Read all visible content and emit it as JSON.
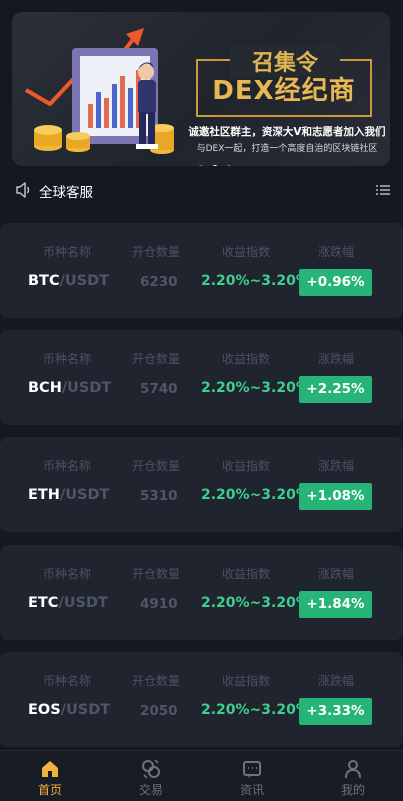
{
  "banner": {
    "top_text": "召集令",
    "main_text": "DEX经纪商",
    "sub_text_1": "诚邀社区群主，资深大V和志愿者加入我们",
    "sub_text_2": "与DEX一起，打造一个高度自治的区块链社区",
    "dots_count": 3,
    "active_dot": 2
  },
  "notice": {
    "label": "全球客服"
  },
  "market": {
    "headers": [
      "币种名称",
      "开仓数量",
      "收益指数",
      "涨跌幅"
    ],
    "rows": [
      {
        "base": "BTC",
        "quote": "/USDT",
        "qty": "6230",
        "yield": "2.20%~3.20%",
        "change": "+0.96%"
      },
      {
        "base": "BCH",
        "quote": "/USDT",
        "qty": "5740",
        "yield": "2.20%~3.20%",
        "change": "+2.25%"
      },
      {
        "base": "ETH",
        "quote": "/USDT",
        "qty": "5310",
        "yield": "2.20%~3.20%",
        "change": "+1.08%"
      },
      {
        "base": "ETC",
        "quote": "/USDT",
        "qty": "4910",
        "yield": "2.20%~3.20%",
        "change": "+1.84%"
      },
      {
        "base": "EOS",
        "quote": "/USDT",
        "qty": "2050",
        "yield": "2.20%~3.20%",
        "change": "+3.33%"
      }
    ]
  },
  "tabbar": {
    "items": [
      {
        "label": "首页",
        "icon": "home-icon",
        "active": true
      },
      {
        "label": "交易",
        "icon": "trade-icon",
        "active": false
      },
      {
        "label": "资讯",
        "icon": "news-icon",
        "active": false
      },
      {
        "label": "我的",
        "icon": "profile-icon",
        "active": false
      }
    ]
  },
  "colors": {
    "background": "#131821",
    "card": "#1f242e",
    "accent_green": "#26b478",
    "yield_green": "#3ecf8e",
    "active_tab": "#f2b53b",
    "banner_gold": "#e2b452"
  }
}
